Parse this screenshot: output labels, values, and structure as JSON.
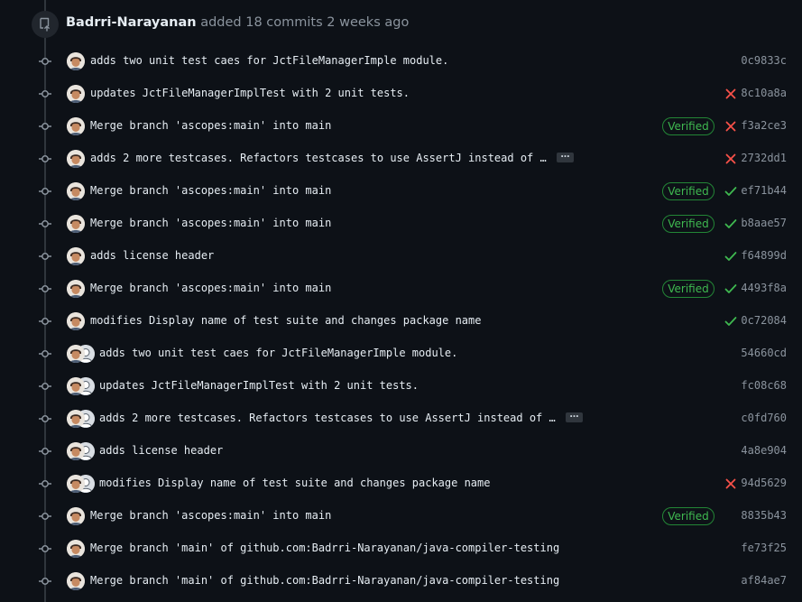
{
  "header": {
    "author": "Badrri-Narayanan",
    "action": "added 18 commits 2 weeks ago"
  },
  "commits": [
    {
      "message": "adds two unit test caes for JctFileManagerImple module.",
      "sha": "0c9833c",
      "verified": false,
      "status": "none",
      "coauthor": false,
      "truncated": false
    },
    {
      "message": "updates JctFileManagerImplTest with 2 unit tests.",
      "sha": "8c10a8a",
      "verified": false,
      "status": "failure",
      "coauthor": false,
      "truncated": false
    },
    {
      "message": "Merge branch 'ascopes:main' into main",
      "sha": "f3a2ce3",
      "verified": true,
      "status": "failure",
      "coauthor": false,
      "truncated": false
    },
    {
      "message": "adds 2 more testcases. Refactors testcases to use AssertJ instead of …",
      "sha": "2732dd1",
      "verified": false,
      "status": "failure",
      "coauthor": false,
      "truncated": true
    },
    {
      "message": "Merge branch 'ascopes:main' into main",
      "sha": "ef71b44",
      "verified": true,
      "status": "success",
      "coauthor": false,
      "truncated": false
    },
    {
      "message": "Merge branch 'ascopes:main' into main",
      "sha": "b8aae57",
      "verified": true,
      "status": "success",
      "coauthor": false,
      "truncated": false
    },
    {
      "message": "adds license header",
      "sha": "f64899d",
      "verified": false,
      "status": "success",
      "coauthor": false,
      "truncated": false
    },
    {
      "message": "Merge branch 'ascopes:main' into main",
      "sha": "4493f8a",
      "verified": true,
      "status": "success",
      "coauthor": false,
      "truncated": false
    },
    {
      "message": "modifies Display name of test suite and changes package name",
      "sha": "0c72084",
      "verified": false,
      "status": "success",
      "coauthor": false,
      "truncated": false
    },
    {
      "message": "adds two unit test caes for JctFileManagerImple module.",
      "sha": "54660cd",
      "verified": false,
      "status": "none",
      "coauthor": true,
      "truncated": false
    },
    {
      "message": "updates JctFileManagerImplTest with 2 unit tests.",
      "sha": "fc08c68",
      "verified": false,
      "status": "none",
      "coauthor": true,
      "truncated": false
    },
    {
      "message": "adds 2 more testcases. Refactors testcases to use AssertJ instead of …",
      "sha": "c0fd760",
      "verified": false,
      "status": "none",
      "coauthor": true,
      "truncated": true
    },
    {
      "message": "adds license header",
      "sha": "4a8e904",
      "verified": false,
      "status": "none",
      "coauthor": true,
      "truncated": false
    },
    {
      "message": "modifies Display name of test suite and changes package name",
      "sha": "94d5629",
      "verified": false,
      "status": "failure",
      "coauthor": true,
      "truncated": false
    },
    {
      "message": "Merge branch 'ascopes:main' into main",
      "sha": "8835b43",
      "verified": true,
      "status": "none",
      "coauthor": false,
      "truncated": false
    },
    {
      "message": "Merge branch 'main' of github.com:Badrri-Narayanan/java-compiler-testing",
      "sha": "fe73f25",
      "verified": false,
      "status": "none",
      "coauthor": false,
      "truncated": false
    },
    {
      "message": "Merge branch 'main' of github.com:Badrri-Narayanan/java-compiler-testing",
      "sha": "af84ae7",
      "verified": false,
      "status": "none",
      "coauthor": false,
      "truncated": false
    }
  ],
  "labels": {
    "verified": "Verified",
    "ellipsis": "…"
  },
  "icons": {
    "push": "repo-push-icon",
    "commit": "git-commit-icon",
    "success": "check-icon",
    "failure": "x-icon"
  },
  "colors": {
    "background": "#0d1117",
    "success": "#3fb950",
    "failure": "#f85149",
    "verified_border": "#238636",
    "muted": "#8b949e"
  }
}
